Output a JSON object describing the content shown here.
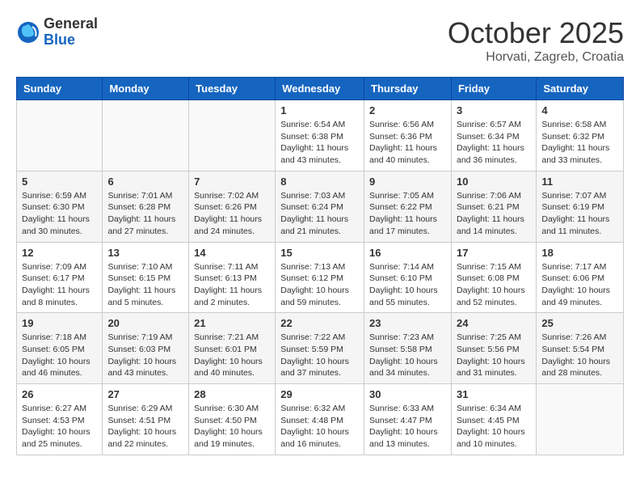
{
  "header": {
    "logo": {
      "general": "General",
      "blue": "Blue"
    },
    "title": "October 2025",
    "location": "Horvati, Zagreb, Croatia"
  },
  "weekdays": [
    "Sunday",
    "Monday",
    "Tuesday",
    "Wednesday",
    "Thursday",
    "Friday",
    "Saturday"
  ],
  "weeks": [
    {
      "shaded": false,
      "days": [
        {
          "num": "",
          "info": ""
        },
        {
          "num": "",
          "info": ""
        },
        {
          "num": "",
          "info": ""
        },
        {
          "num": "1",
          "info": "Sunrise: 6:54 AM\nSunset: 6:38 PM\nDaylight: 11 hours\nand 43 minutes."
        },
        {
          "num": "2",
          "info": "Sunrise: 6:56 AM\nSunset: 6:36 PM\nDaylight: 11 hours\nand 40 minutes."
        },
        {
          "num": "3",
          "info": "Sunrise: 6:57 AM\nSunset: 6:34 PM\nDaylight: 11 hours\nand 36 minutes."
        },
        {
          "num": "4",
          "info": "Sunrise: 6:58 AM\nSunset: 6:32 PM\nDaylight: 11 hours\nand 33 minutes."
        }
      ]
    },
    {
      "shaded": true,
      "days": [
        {
          "num": "5",
          "info": "Sunrise: 6:59 AM\nSunset: 6:30 PM\nDaylight: 11 hours\nand 30 minutes."
        },
        {
          "num": "6",
          "info": "Sunrise: 7:01 AM\nSunset: 6:28 PM\nDaylight: 11 hours\nand 27 minutes."
        },
        {
          "num": "7",
          "info": "Sunrise: 7:02 AM\nSunset: 6:26 PM\nDaylight: 11 hours\nand 24 minutes."
        },
        {
          "num": "8",
          "info": "Sunrise: 7:03 AM\nSunset: 6:24 PM\nDaylight: 11 hours\nand 21 minutes."
        },
        {
          "num": "9",
          "info": "Sunrise: 7:05 AM\nSunset: 6:22 PM\nDaylight: 11 hours\nand 17 minutes."
        },
        {
          "num": "10",
          "info": "Sunrise: 7:06 AM\nSunset: 6:21 PM\nDaylight: 11 hours\nand 14 minutes."
        },
        {
          "num": "11",
          "info": "Sunrise: 7:07 AM\nSunset: 6:19 PM\nDaylight: 11 hours\nand 11 minutes."
        }
      ]
    },
    {
      "shaded": false,
      "days": [
        {
          "num": "12",
          "info": "Sunrise: 7:09 AM\nSunset: 6:17 PM\nDaylight: 11 hours\nand 8 minutes."
        },
        {
          "num": "13",
          "info": "Sunrise: 7:10 AM\nSunset: 6:15 PM\nDaylight: 11 hours\nand 5 minutes."
        },
        {
          "num": "14",
          "info": "Sunrise: 7:11 AM\nSunset: 6:13 PM\nDaylight: 11 hours\nand 2 minutes."
        },
        {
          "num": "15",
          "info": "Sunrise: 7:13 AM\nSunset: 6:12 PM\nDaylight: 10 hours\nand 59 minutes."
        },
        {
          "num": "16",
          "info": "Sunrise: 7:14 AM\nSunset: 6:10 PM\nDaylight: 10 hours\nand 55 minutes."
        },
        {
          "num": "17",
          "info": "Sunrise: 7:15 AM\nSunset: 6:08 PM\nDaylight: 10 hours\nand 52 minutes."
        },
        {
          "num": "18",
          "info": "Sunrise: 7:17 AM\nSunset: 6:06 PM\nDaylight: 10 hours\nand 49 minutes."
        }
      ]
    },
    {
      "shaded": true,
      "days": [
        {
          "num": "19",
          "info": "Sunrise: 7:18 AM\nSunset: 6:05 PM\nDaylight: 10 hours\nand 46 minutes."
        },
        {
          "num": "20",
          "info": "Sunrise: 7:19 AM\nSunset: 6:03 PM\nDaylight: 10 hours\nand 43 minutes."
        },
        {
          "num": "21",
          "info": "Sunrise: 7:21 AM\nSunset: 6:01 PM\nDaylight: 10 hours\nand 40 minutes."
        },
        {
          "num": "22",
          "info": "Sunrise: 7:22 AM\nSunset: 5:59 PM\nDaylight: 10 hours\nand 37 minutes."
        },
        {
          "num": "23",
          "info": "Sunrise: 7:23 AM\nSunset: 5:58 PM\nDaylight: 10 hours\nand 34 minutes."
        },
        {
          "num": "24",
          "info": "Sunrise: 7:25 AM\nSunset: 5:56 PM\nDaylight: 10 hours\nand 31 minutes."
        },
        {
          "num": "25",
          "info": "Sunrise: 7:26 AM\nSunset: 5:54 PM\nDaylight: 10 hours\nand 28 minutes."
        }
      ]
    },
    {
      "shaded": false,
      "days": [
        {
          "num": "26",
          "info": "Sunrise: 6:27 AM\nSunset: 4:53 PM\nDaylight: 10 hours\nand 25 minutes."
        },
        {
          "num": "27",
          "info": "Sunrise: 6:29 AM\nSunset: 4:51 PM\nDaylight: 10 hours\nand 22 minutes."
        },
        {
          "num": "28",
          "info": "Sunrise: 6:30 AM\nSunset: 4:50 PM\nDaylight: 10 hours\nand 19 minutes."
        },
        {
          "num": "29",
          "info": "Sunrise: 6:32 AM\nSunset: 4:48 PM\nDaylight: 10 hours\nand 16 minutes."
        },
        {
          "num": "30",
          "info": "Sunrise: 6:33 AM\nSunset: 4:47 PM\nDaylight: 10 hours\nand 13 minutes."
        },
        {
          "num": "31",
          "info": "Sunrise: 6:34 AM\nSunset: 4:45 PM\nDaylight: 10 hours\nand 10 minutes."
        },
        {
          "num": "",
          "info": ""
        }
      ]
    }
  ]
}
